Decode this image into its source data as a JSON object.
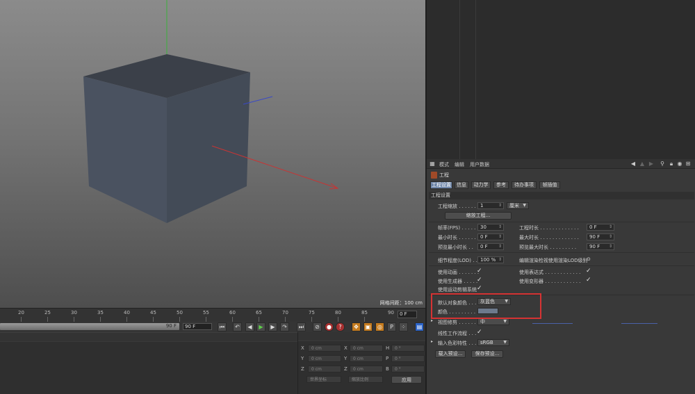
{
  "viewport": {
    "grid_label": "网格间距：100 cm"
  },
  "timeline": {
    "ticks": [
      "20",
      "25",
      "30",
      "35",
      "40",
      "45",
      "50",
      "55",
      "60",
      "65",
      "70",
      "75",
      "80",
      "85",
      "90"
    ],
    "current_frame": "0 F"
  },
  "transport": {
    "range_end": "90 F",
    "end_frame": "90 F"
  },
  "coordinates": {
    "rows": [
      {
        "a1": "X",
        "v1": "0 cm",
        "a2": "X",
        "v2": "0 cm",
        "a3": "H",
        "v3": "0 °"
      },
      {
        "a1": "Y",
        "v1": "0 cm",
        "a2": "Y",
        "v2": "0 cm",
        "a3": "P",
        "v3": "0 °"
      },
      {
        "a1": "Z",
        "v1": "0 cm",
        "a2": "Z",
        "v2": "0 cm",
        "a3": "B",
        "v3": "0 °"
      }
    ],
    "mode_select": "世界坐标",
    "scale_select": "缩放比例",
    "apply_label": "应用"
  },
  "attr": {
    "menu": [
      "模式",
      "编辑",
      "用户数据"
    ],
    "title": "工程",
    "tabs": [
      "工程设置",
      "信息",
      "动力学",
      "参考",
      "待办事项",
      "帧插值"
    ],
    "section": "工程设置",
    "project_scale_label": "工程缩放 . . . . . .",
    "project_scale_value": "1",
    "project_scale_unit": "厘米",
    "scale_project_btn": "缩放工程...",
    "fps_label": "帧率(FPS) . . . . . .",
    "fps_value": "30",
    "duration_label": "工程时长 . . . . . . . . . . . . .",
    "duration_value": "0 F",
    "min_time_label": "最小时长 . . . . . .",
    "min_time_value": "0 F",
    "max_time_label": "最大时长 . . . . . . . . . . . . .",
    "max_time_value": "90 F",
    "preview_min_label": "预览最小时长 . .",
    "preview_min_value": "0 F",
    "preview_max_label": "预览最大时长 . . . . . . . . .",
    "preview_max_value": "90 F",
    "lod_label": "细节程度(LOD) . . .",
    "lod_value": "100 %",
    "lod_render_label": "编辑渲染检视使用渲染LOD级别",
    "use_anim_label": "使用动画 . . . . . . .",
    "use_expr_label": "使用表达式 . . . . . . . . . . . .",
    "use_gen_label": "使用生成器 . . . . .",
    "use_deform_label": "使用变形器 . . . . . . . . . . . .",
    "use_motion_label": "使用运动剪辑系统",
    "default_color_label": "默认对象颜色 . . .",
    "default_color_value": "灰蓝色",
    "color_label": "颜色 . . . . . . . . . . .",
    "view_clip_label": "视图修剪 . . . . . . .",
    "view_clip_value": "中",
    "linear_workflow_label": "线性工作流程 . . .",
    "input_color_label": "输入色彩特性 . . .",
    "input_color_value": "sRGB",
    "load_preset_btn": "载入预设...",
    "save_preset_btn": "保存预设..."
  },
  "colors": {
    "accent_tab": "#6f86a8",
    "highlight": "#d63333",
    "swatch": "#6d7a8c"
  }
}
